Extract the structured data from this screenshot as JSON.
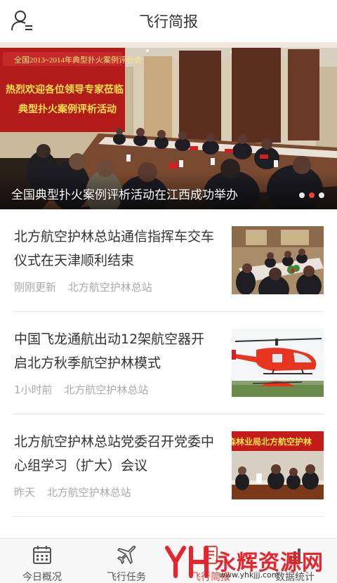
{
  "header": {
    "title": "飞行简报"
  },
  "banner": {
    "caption": "全国典型扑火案例评析活动在江西成功举办",
    "screen_line1": "热烈欢迎各位领导专家莅临",
    "screen_line2": "典型扑火案例评析活动",
    "screen_top": "全国2013~2014年典型扑火案例评析会",
    "slides": 3,
    "active_slide": 2
  },
  "news": [
    {
      "title": "北方航空护林总站通信指挥车交车仪式在天津顺利结束",
      "time": "刚刚更新",
      "source": "北方航空护林总站"
    },
    {
      "title": "中国飞龙通航出动12架航空器开启北方秋季航空护林模式",
      "time": "1小时前",
      "source": "北方航空护林总站"
    },
    {
      "title": "北方航空护林总站党委召开党委中心组学习（扩大）会议",
      "time": "昨天",
      "source": "北方航空护林总站",
      "thumb_banner": "森林业局北方航空护林"
    }
  ],
  "tabs": [
    {
      "label": "今日概况",
      "icon": "calendar-icon"
    },
    {
      "label": "飞行任务",
      "icon": "airplane-icon"
    },
    {
      "label": "飞行简报",
      "icon": "document-icon",
      "active": true
    },
    {
      "label": "数据统计",
      "icon": "chart-icon"
    }
  ],
  "watermark": {
    "text": "永辉资源网",
    "url": "www.yhkjjj.com"
  },
  "colors": {
    "accent": "#e8443a",
    "text": "#333333",
    "meta": "#aaaaaa"
  }
}
